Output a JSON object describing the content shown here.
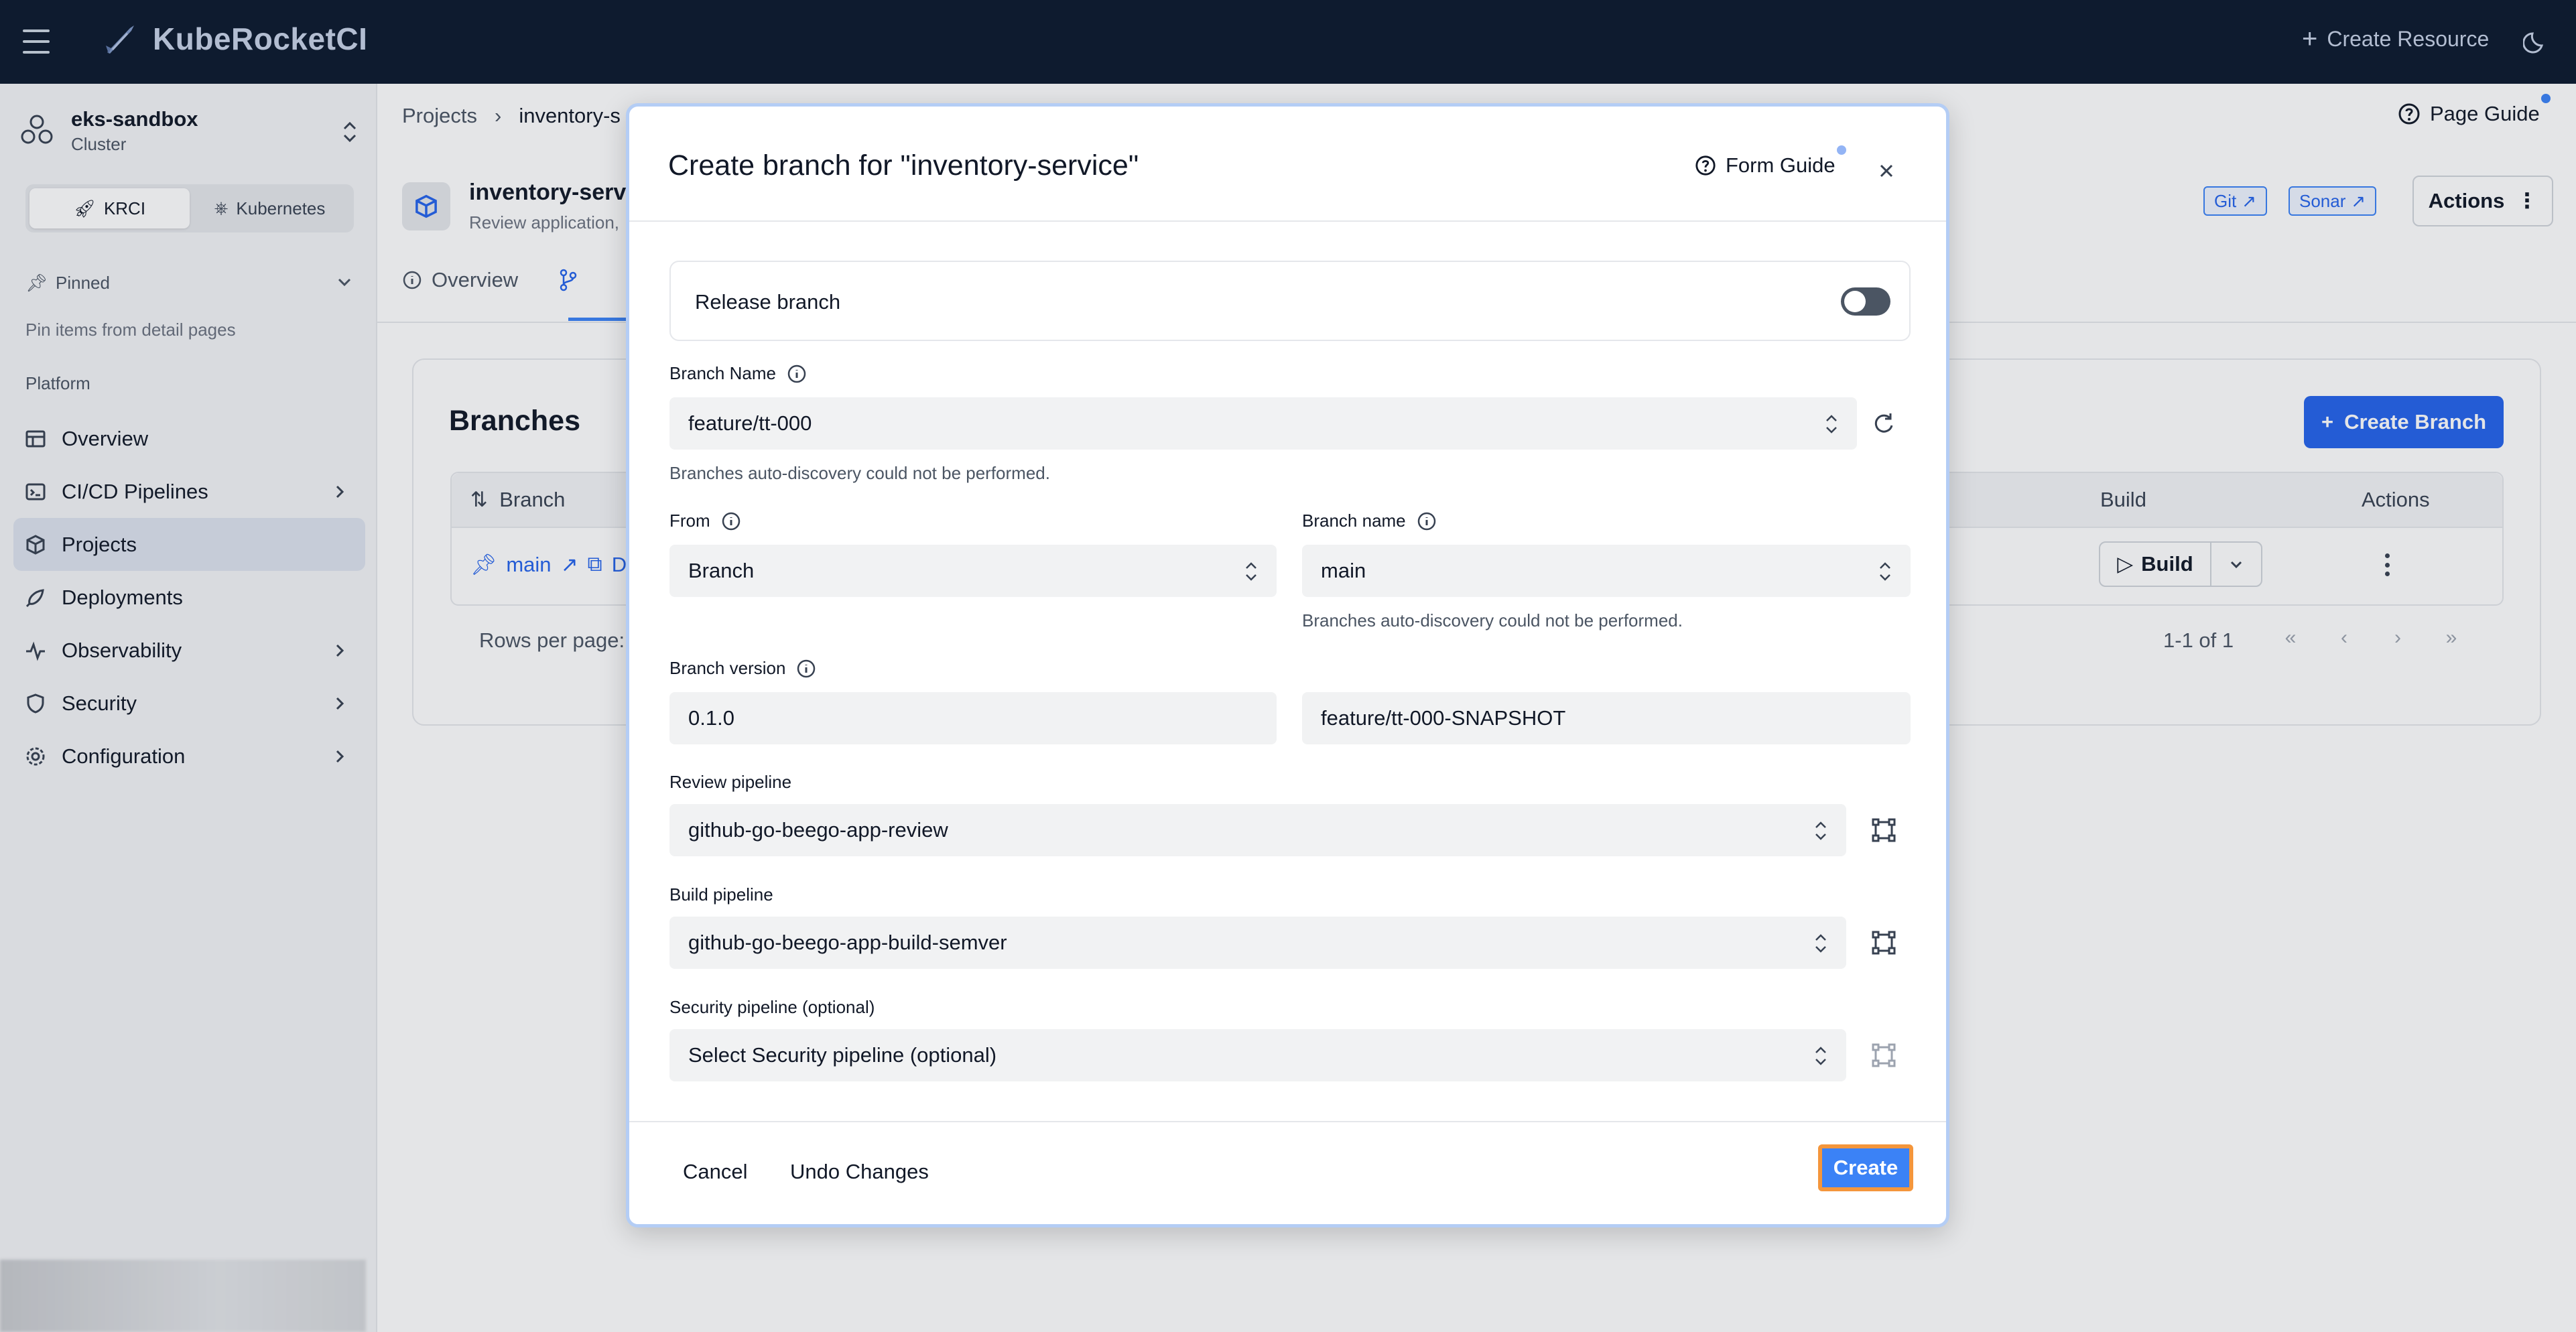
{
  "topbar": {
    "app_name": "KubeRocketCI",
    "create_resource_label": "Create Resource"
  },
  "sidebar": {
    "cluster_name": "eks-sandbox",
    "cluster_label": "Cluster",
    "segments": [
      {
        "label": "KRCI",
        "active": true
      },
      {
        "label": "Kubernetes",
        "active": false
      }
    ],
    "pinned_label": "Pinned",
    "pinned_hint": "Pin items from detail pages",
    "section_label": "Platform",
    "items": [
      {
        "label": "Overview",
        "icon": "table-icon",
        "has_arrow": false
      },
      {
        "label": "CI/CD Pipelines",
        "icon": "pipeline-icon",
        "has_arrow": true
      },
      {
        "label": "Projects",
        "icon": "cube-icon",
        "has_arrow": false,
        "active": true
      },
      {
        "label": "Deployments",
        "icon": "rocket-icon",
        "has_arrow": false
      },
      {
        "label": "Observability",
        "icon": "activity-icon",
        "has_arrow": true
      },
      {
        "label": "Security",
        "icon": "shield-icon",
        "has_arrow": true
      },
      {
        "label": "Configuration",
        "icon": "gear-icon",
        "has_arrow": true
      }
    ]
  },
  "main": {
    "breadcrumb": [
      "Projects",
      "inventory-s"
    ],
    "page_guide_label": "Page Guide",
    "project_title": "inventory-serv",
    "project_subtitle": "Review application,",
    "tags": [
      "Git",
      "Sonar"
    ],
    "actions_label": "Actions",
    "tabs": [
      {
        "label": "Overview",
        "icon": "info-icon"
      },
      {
        "label": "",
        "icon": "branch-icon"
      }
    ],
    "branches_title": "Branches",
    "create_branch_label": "Create Branch",
    "table": {
      "col_branch": "Branch",
      "col_build": "Build",
      "col_actions": "Actions",
      "row_branch": "main",
      "row_badge": "D",
      "build_label": "Build"
    },
    "rows_per_page_label": "Rows per page:",
    "pager_info": "1-1 of 1",
    "pager_buttons": [
      "«",
      "‹",
      "›",
      "»"
    ]
  },
  "modal": {
    "title": "Create branch for \"inventory-service\"",
    "form_guide_label": "Form Guide",
    "release_branch_label": "Release branch",
    "release_branch_on": false,
    "branch_name_label": "Branch Name",
    "branch_name_value": "feature/tt-000",
    "autodiscovery_hint": "Branches auto-discovery could not be performed.",
    "from_label": "From",
    "from_value": "Branch",
    "source_branch_label": "Branch name",
    "source_branch_value": "main",
    "source_hint": "Branches auto-discovery could not be performed.",
    "branch_version_label": "Branch version",
    "branch_version_value": "0.1.0",
    "version_suffix_value": "feature/tt-000-SNAPSHOT",
    "review_pipeline_label": "Review pipeline",
    "review_pipeline_value": "github-go-beego-app-review",
    "build_pipeline_label": "Build pipeline",
    "build_pipeline_value": "github-go-beego-app-build-semver",
    "security_pipeline_label": "Security pipeline (optional)",
    "security_pipeline_placeholder": "Select Security pipeline (optional)",
    "cancel_label": "Cancel",
    "undo_label": "Undo Changes",
    "create_label": "Create"
  },
  "colors": {
    "topbar_bg": "#0c1a2e",
    "accent": "#3b82f6",
    "focus_ring": "#f4963c"
  }
}
